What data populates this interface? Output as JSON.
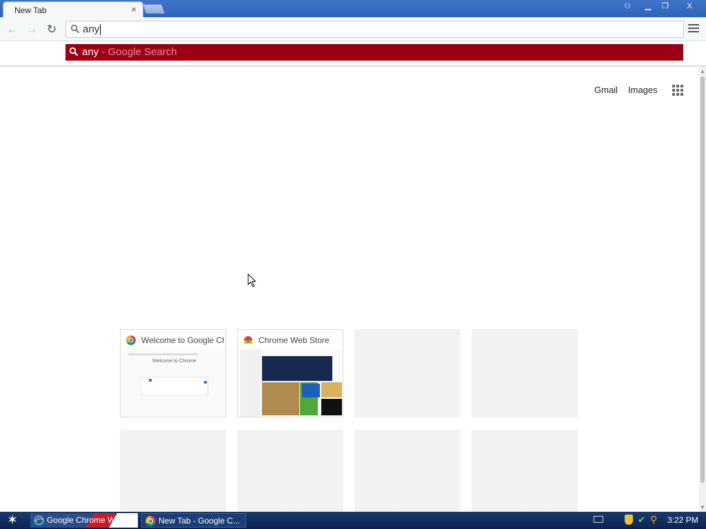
{
  "window": {
    "tab_title": "New Tab",
    "tab_close_glyph": "×",
    "profile_glyph": "⚇",
    "minimize_glyph": "▁",
    "restore_glyph": "❐",
    "close_glyph": "X"
  },
  "toolbar": {
    "back_glyph": "←",
    "forward_glyph": "→",
    "reload_glyph": "↻",
    "omnibox_value": "any"
  },
  "dropdown": {
    "query": "any",
    "suffix": " - Google Search",
    "highlight_color": "#9b0014"
  },
  "page": {
    "gmail_label": "Gmail",
    "images_label": "Images",
    "tiles": [
      {
        "title": "Welcome to Google Chrome",
        "thumb_title": "Welcome to Chrome"
      },
      {
        "title": "Chrome Web Store"
      }
    ]
  },
  "taskbar": {
    "start_glyph": "✶",
    "items": [
      {
        "label": "Google Chrome Web..."
      },
      {
        "label": "New Tab - Google C..."
      }
    ],
    "clock": "3:22 PM"
  },
  "icons": {
    "search": "search-icon",
    "apps": "apps-grid-icon",
    "menu": "hamburger-menu-icon",
    "chrome": "chrome-logo-icon",
    "ie": "internet-explorer-icon"
  }
}
